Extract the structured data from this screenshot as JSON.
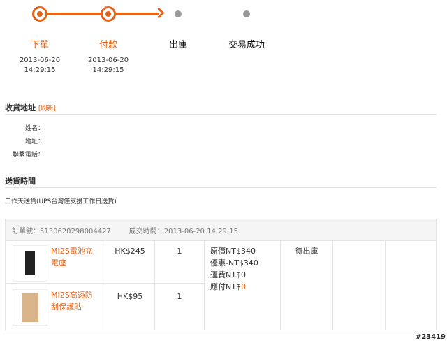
{
  "progress": {
    "steps": [
      {
        "label": "下單",
        "date": "2013-06-20",
        "time": "14:29:15",
        "done": true
      },
      {
        "label": "付款",
        "date": "2013-06-20",
        "time": "14:29:15",
        "done": true
      },
      {
        "label": "出庫",
        "done": false
      },
      {
        "label": "交易成功",
        "done": false
      }
    ],
    "accent": "#e8641b"
  },
  "address": {
    "title": "收貨地址",
    "refresh": "[刷新]",
    "fields": [
      "姓名：",
      "地址：",
      "聯繫電話："
    ]
  },
  "delivery": {
    "title": "送貨時間",
    "value": "工作天送貨(UPS台灣僅支援工作日送貨)"
  },
  "order": {
    "number_label": "訂單號：",
    "number": "5130620298004427",
    "time_label": "成交時間：",
    "time": "2013-06-20 14:29:15",
    "items": [
      {
        "name": "MI2S電池充電座",
        "price": "HK$245",
        "qty": "1"
      },
      {
        "name": "MI2S高透防刮保護貼",
        "price": "HK$95",
        "qty": "1"
      }
    ],
    "summary": {
      "original": "原價NT$340",
      "discount": "優惠-NT$340",
      "shipping": "運費NT$0",
      "due_label": "應付NT$",
      "due_value": "0"
    },
    "status": "待出庫"
  },
  "watermark": "#23419"
}
